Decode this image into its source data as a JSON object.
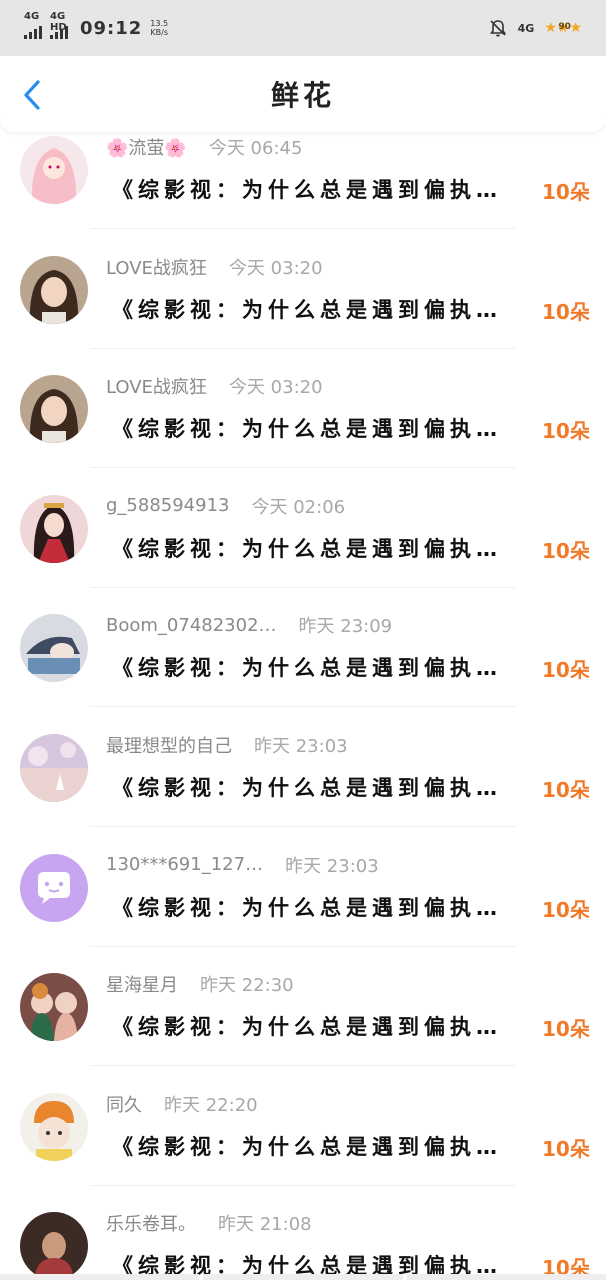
{
  "status_bar": {
    "net_left_1": "4G",
    "net_left_2": "4G HD",
    "time": "09:12",
    "speed_value": "13.5",
    "speed_unit": "KB/s",
    "net_right": "4G",
    "battery": "90"
  },
  "header": {
    "title": "鲜花"
  },
  "colors": {
    "accent": "#f07a2a",
    "back": "#2b8cf2",
    "chat_bubble_bg": "#c7a5f0"
  },
  "list": [
    {
      "name": "🌸流萤🌸",
      "time": "今天 06:45",
      "book": "《综影视：为什么总是遇到偏执…",
      "count": "10朵",
      "avatar_icon": "pink-hair-girl-avatar"
    },
    {
      "name": "LOVE战疯狂",
      "time": "今天 03:20",
      "book": "《综影视：为什么总是遇到偏执…",
      "count": "10朵",
      "avatar_icon": "girl-photo-avatar"
    },
    {
      "name": "LOVE战疯狂",
      "time": "今天 03:20",
      "book": "《综影视：为什么总是遇到偏执…",
      "count": "10朵",
      "avatar_icon": "girl-photo-avatar"
    },
    {
      "name": "g_588594913",
      "time": "今天 02:06",
      "book": "《综影视：为什么总是遇到偏执…",
      "count": "10朵",
      "avatar_icon": "hanfu-girl-avatar"
    },
    {
      "name": "Boom_07482302…",
      "time": "昨天 23:09",
      "book": "《综影视：为什么总是遇到偏执…",
      "count": "10朵",
      "avatar_icon": "anime-boy-avatar"
    },
    {
      "name": "最理想型的自己",
      "time": "昨天 23:03",
      "book": "《综影视：为什么总是遇到偏执…",
      "count": "10朵",
      "avatar_icon": "sky-scene-avatar"
    },
    {
      "name": "130***691_127…",
      "time": "昨天 23:03",
      "book": "《综影视：为什么总是遇到偏执…",
      "count": "10朵",
      "avatar_icon": "chat-bubble-avatar"
    },
    {
      "name": "星海星月",
      "time": "昨天 22:30",
      "book": "《综影视：为什么总是遇到偏执…",
      "count": "10朵",
      "avatar_icon": "two-girls-avatar"
    },
    {
      "name": "同久",
      "time": "昨天 22:20",
      "book": "《综影视：为什么总是遇到偏执…",
      "count": "10朵",
      "avatar_icon": "orange-hat-girl-avatar"
    },
    {
      "name": "乐乐卷耳。",
      "time": "昨天 21:08",
      "book": "《综影视：为什么总是遇到偏执…",
      "count": "10朵",
      "avatar_icon": "dark-photo-avatar"
    }
  ]
}
